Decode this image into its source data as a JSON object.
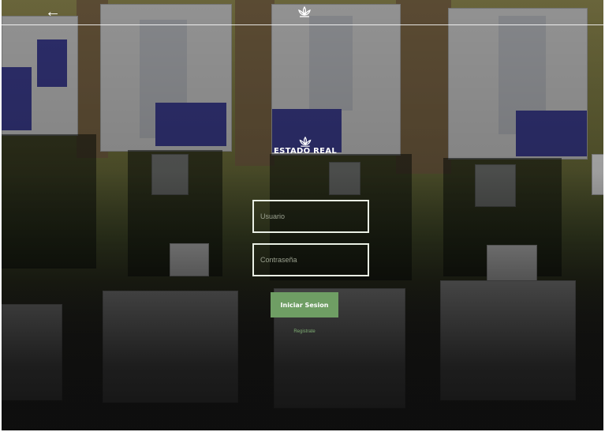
{
  "topbar": {
    "back_icon": "arrow-left-icon",
    "logo_icon": "lotus-icon"
  },
  "brand": {
    "icon": "lotus-icon",
    "title": "ESTADO REAL"
  },
  "login": {
    "username_placeholder": "Usuario",
    "username_value": "",
    "password_placeholder": "Contraseña",
    "password_value": "",
    "submit_label": "Iniciar Sesion",
    "register_label": "Registrate"
  },
  "colors": {
    "accent": "#6f9e64",
    "link": "#7fae74",
    "field_border": "#e9efe4"
  }
}
